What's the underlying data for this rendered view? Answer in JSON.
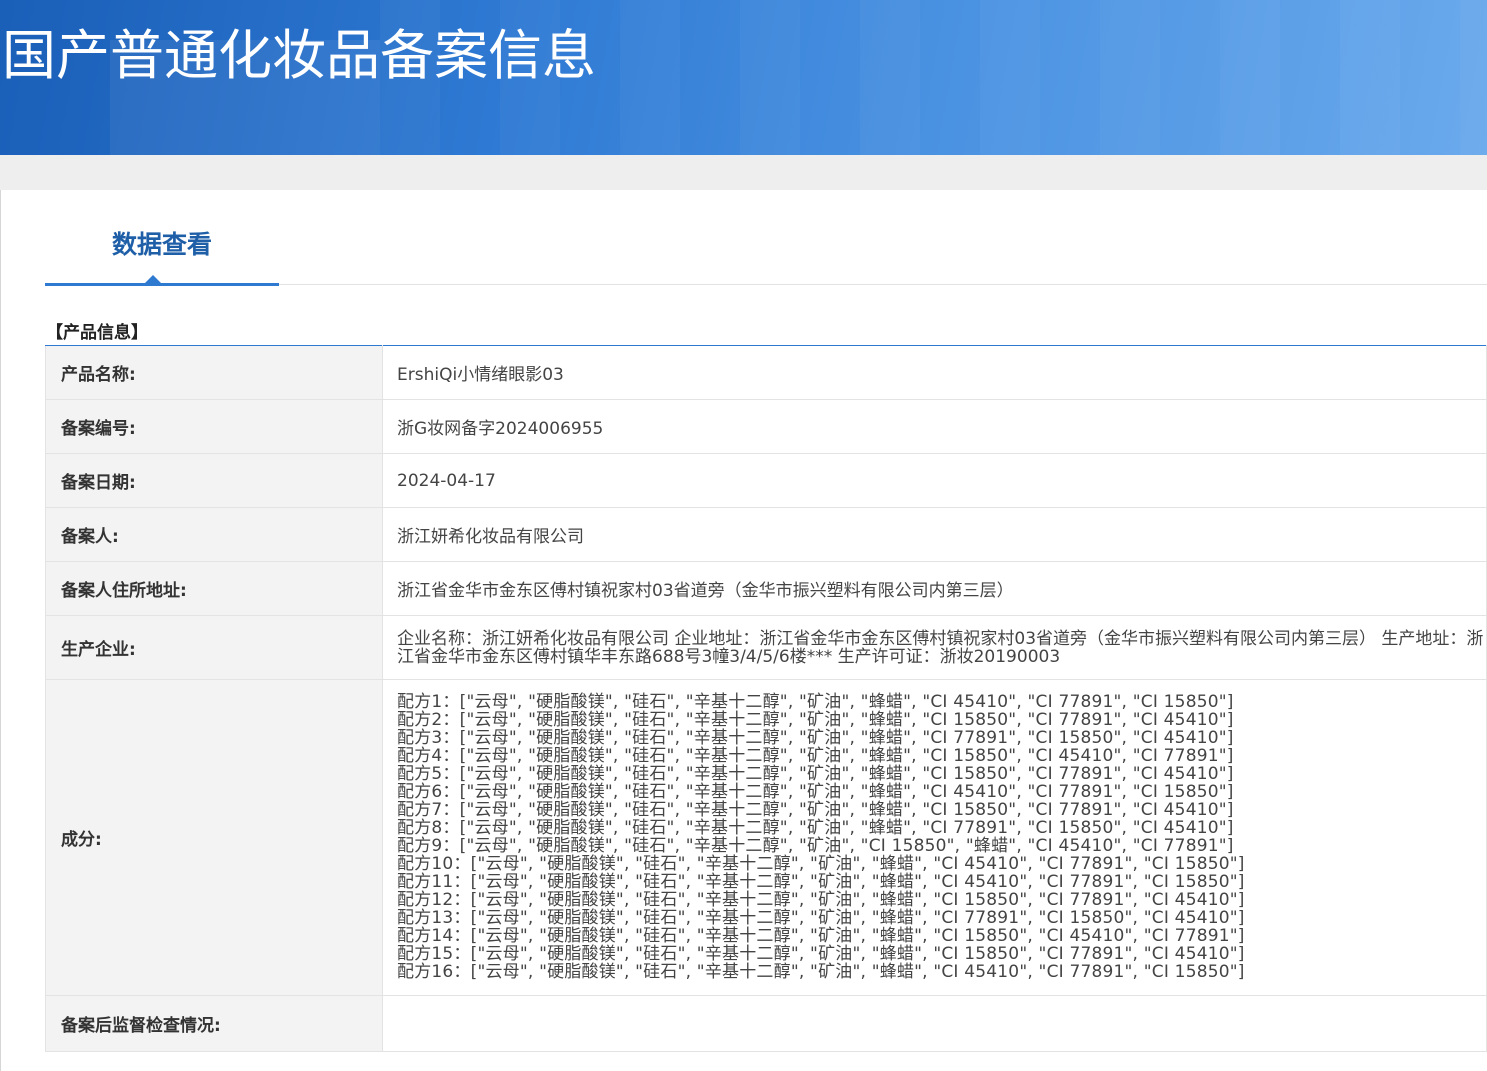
{
  "banner": {
    "title": "国产普通化妆品备案信息"
  },
  "tab": {
    "label": "数据查看"
  },
  "section": {
    "heading": "【产品信息】"
  },
  "rows": [
    {
      "label": "产品名称:",
      "value": "ErshiQi小情绪眼影03"
    },
    {
      "label": "备案编号:",
      "value": "浙G妆网备字2024006955"
    },
    {
      "label": "备案日期:",
      "value": "2024-04-17"
    },
    {
      "label": "备案人:",
      "value": "浙江妍希化妆品有限公司"
    },
    {
      "label": "备案人住所地址:",
      "value": "浙江省金华市金东区傅村镇祝家村03省道旁（金华市振兴塑料有限公司内第三层）"
    },
    {
      "label": "生产企业:",
      "value": "企业名称：浙江妍希化妆品有限公司 企业地址：浙江省金华市金东区傅村镇祝家村03省道旁（金华市振兴塑料有限公司内第三层） 生产地址：浙江省金华市金东区傅村镇华丰东路688号3幢3/4/5/6楼*** 生产许可证：浙妆20190003"
    },
    {
      "label": "成分:",
      "formulas": [
        "配方1：[\"云母\", \"硬脂酸镁\", \"硅石\", \"辛基十二醇\", \"矿油\", \"蜂蜡\", \"CI 45410\", \"CI 77891\", \"CI 15850\"]",
        "配方2：[\"云母\", \"硬脂酸镁\", \"硅石\", \"辛基十二醇\", \"矿油\", \"蜂蜡\", \"CI 15850\", \"CI 77891\", \"CI 45410\"]",
        "配方3：[\"云母\", \"硬脂酸镁\", \"硅石\", \"辛基十二醇\", \"矿油\", \"蜂蜡\", \"CI 77891\", \"CI 15850\", \"CI 45410\"]",
        "配方4：[\"云母\", \"硬脂酸镁\", \"硅石\", \"辛基十二醇\", \"矿油\", \"蜂蜡\", \"CI 15850\", \"CI 45410\", \"CI 77891\"]",
        "配方5：[\"云母\", \"硬脂酸镁\", \"硅石\", \"辛基十二醇\", \"矿油\", \"蜂蜡\", \"CI 15850\", \"CI 77891\", \"CI 45410\"]",
        "配方6：[\"云母\", \"硬脂酸镁\", \"硅石\", \"辛基十二醇\", \"矿油\", \"蜂蜡\", \"CI 45410\", \"CI 77891\", \"CI 15850\"]",
        "配方7：[\"云母\", \"硬脂酸镁\", \"硅石\", \"辛基十二醇\", \"矿油\", \"蜂蜡\", \"CI 15850\", \"CI 77891\", \"CI 45410\"]",
        "配方8：[\"云母\", \"硬脂酸镁\", \"硅石\", \"辛基十二醇\", \"矿油\", \"蜂蜡\", \"CI 77891\", \"CI 15850\", \"CI 45410\"]",
        "配方9：[\"云母\", \"硬脂酸镁\", \"硅石\", \"辛基十二醇\", \"矿油\", \"CI 15850\", \"蜂蜡\", \"CI 45410\", \"CI 77891\"]",
        "配方10：[\"云母\", \"硬脂酸镁\", \"硅石\", \"辛基十二醇\", \"矿油\", \"蜂蜡\", \"CI 45410\", \"CI 77891\", \"CI 15850\"]",
        "配方11：[\"云母\", \"硬脂酸镁\", \"硅石\", \"辛基十二醇\", \"矿油\", \"蜂蜡\", \"CI 45410\", \"CI 77891\", \"CI 15850\"]",
        "配方12：[\"云母\", \"硬脂酸镁\", \"硅石\", \"辛基十二醇\", \"矿油\", \"蜂蜡\", \"CI 15850\", \"CI 77891\", \"CI 45410\"]",
        "配方13：[\"云母\", \"硬脂酸镁\", \"硅石\", \"辛基十二醇\", \"矿油\", \"蜂蜡\", \"CI 77891\", \"CI 15850\", \"CI 45410\"]",
        "配方14：[\"云母\", \"硬脂酸镁\", \"硅石\", \"辛基十二醇\", \"矿油\", \"蜂蜡\", \"CI 15850\", \"CI 45410\", \"CI 77891\"]",
        "配方15：[\"云母\", \"硬脂酸镁\", \"硅石\", \"辛基十二醇\", \"矿油\", \"蜂蜡\", \"CI 15850\", \"CI 77891\", \"CI 45410\"]",
        "配方16：[\"云母\", \"硬脂酸镁\", \"硅石\", \"辛基十二醇\", \"矿油\", \"蜂蜡\", \"CI 45410\", \"CI 77891\", \"CI 15850\"]"
      ]
    },
    {
      "label": "备案后监督检查情况:",
      "value": ""
    }
  ]
}
